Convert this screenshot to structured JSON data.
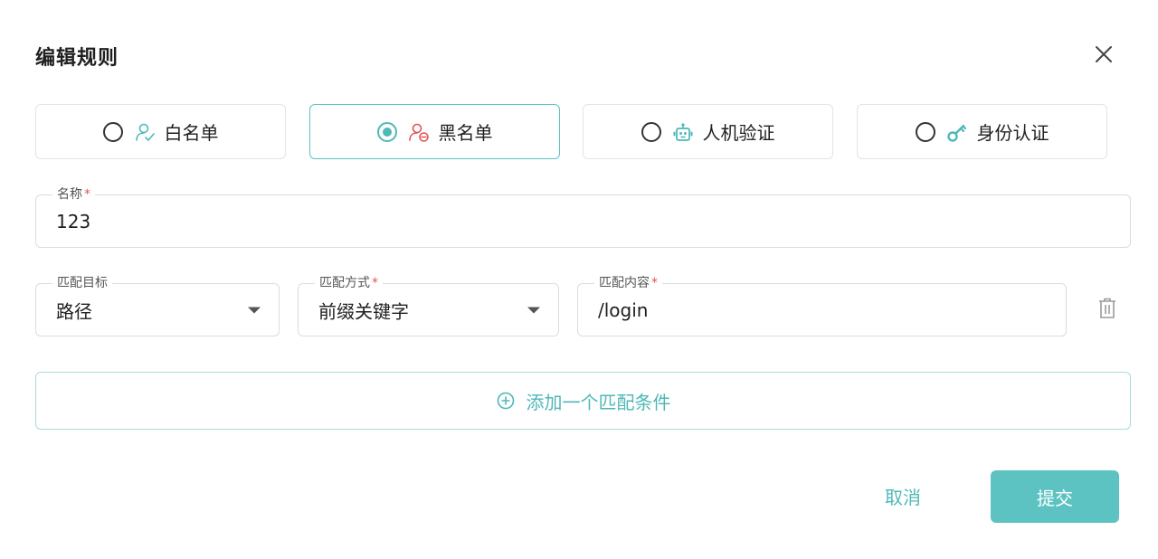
{
  "dialog": {
    "title": "编辑规则"
  },
  "rule_types": [
    {
      "label": "白名单",
      "icon": "user-check-icon",
      "selected": false
    },
    {
      "label": "黑名单",
      "icon": "user-block-icon",
      "selected": true
    },
    {
      "label": "人机验证",
      "icon": "robot-icon",
      "selected": false
    },
    {
      "label": "身份认证",
      "icon": "key-icon",
      "selected": false
    }
  ],
  "name_field": {
    "label": "名称",
    "required": "*",
    "value": "123"
  },
  "condition": {
    "target": {
      "label": "匹配目标",
      "value": "路径"
    },
    "method": {
      "label": "匹配方式",
      "required": "*",
      "value": "前缀关键字"
    },
    "content": {
      "label": "匹配内容",
      "required": "*",
      "value": "/login"
    }
  },
  "add_condition_label": "添加一个匹配条件",
  "footer": {
    "cancel_label": "取消",
    "submit_label": "提交"
  },
  "colors": {
    "accent": "#4fb8b7",
    "danger": "#e05656",
    "border": "#dcdcdc"
  }
}
